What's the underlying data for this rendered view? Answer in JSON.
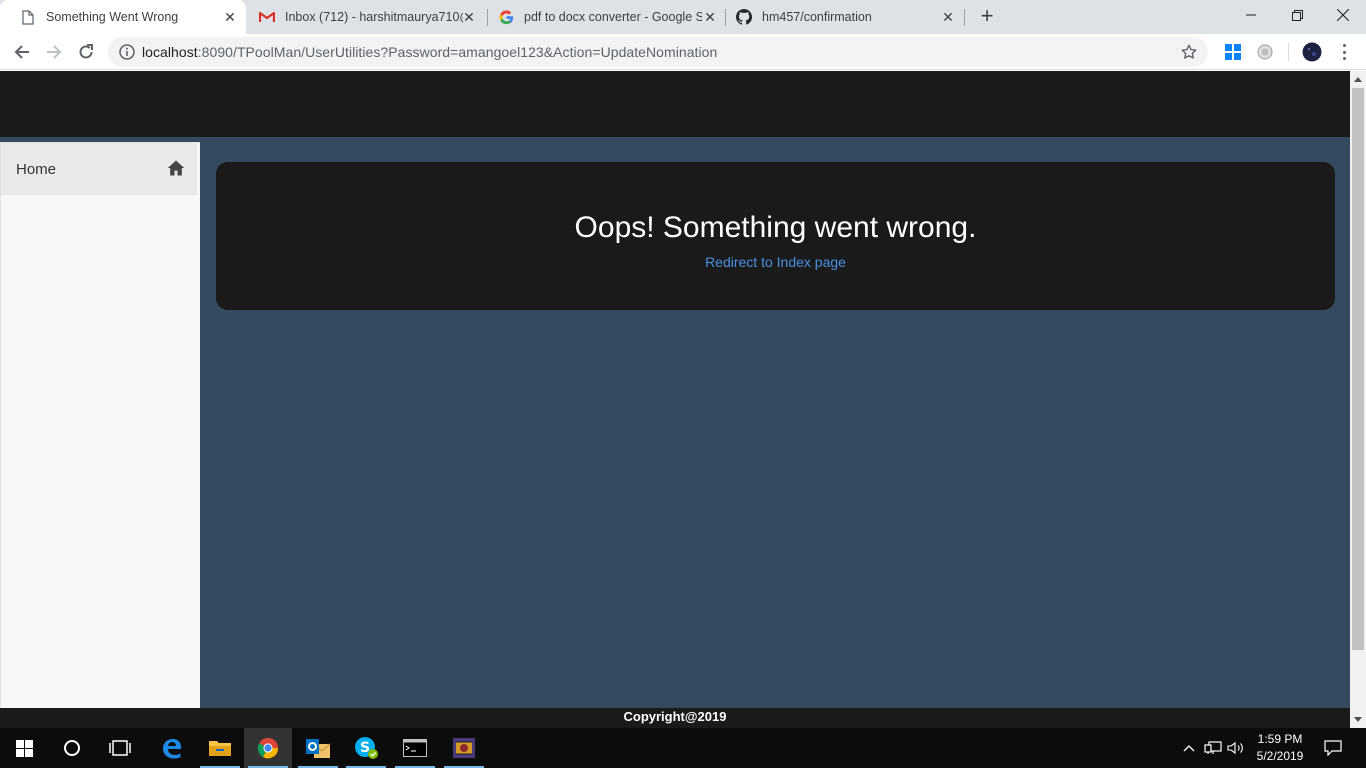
{
  "browser": {
    "tabs": [
      {
        "title": "Something Went Wrong",
        "icon": "page-icon",
        "active": true
      },
      {
        "title": "Inbox (712) - harshitmaurya710@",
        "icon": "gmail-icon",
        "active": false
      },
      {
        "title": "pdf to docx converter - Google S",
        "icon": "google-icon",
        "active": false
      },
      {
        "title": "hm457/confirmation",
        "icon": "github-icon",
        "active": false
      }
    ],
    "new_tab_label": "+",
    "url_host": "localhost",
    "url_rest": ":8090/TPoolMan/UserUtilities?Password=amangoel123&Action=UpdateNomination"
  },
  "page": {
    "sidebar": {
      "items": [
        {
          "label": "Home",
          "icon": "home-icon"
        }
      ]
    },
    "error": {
      "title": "Oops! Something went wrong.",
      "link_text": "Redirect to Index page"
    },
    "footer": "Copyright@2019"
  },
  "taskbar": {
    "apps": [
      "start-icon",
      "cortana-icon",
      "task-view-icon",
      "edge-icon",
      "file-explorer-icon",
      "chrome-icon",
      "outlook-icon",
      "skype-icon",
      "terminal-icon",
      "app-icon"
    ],
    "clock": {
      "time": "1:59 PM",
      "date": "5/2/2019"
    }
  },
  "colors": {
    "page_bg": "#354a5f",
    "header_bg": "#1a1a1a",
    "link": "#4a90e2",
    "sidebar_bg": "#f7f7f7"
  }
}
